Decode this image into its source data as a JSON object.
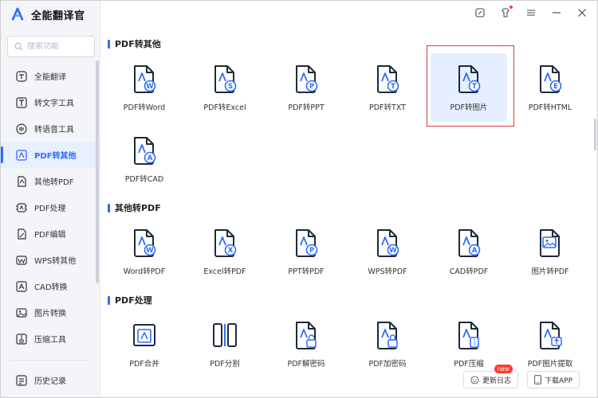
{
  "app": {
    "title": "全能翻译官"
  },
  "search": {
    "placeholder": "搜索功能"
  },
  "sidebar": {
    "items": [
      {
        "label": "全能翻译",
        "icon": "translate-icon",
        "active": false
      },
      {
        "label": "转文字工具",
        "icon": "text-convert-icon",
        "active": false
      },
      {
        "label": "转语音工具",
        "icon": "voice-convert-icon",
        "active": false
      },
      {
        "label": "PDF转其他",
        "icon": "pdf-convert-icon",
        "active": true
      },
      {
        "label": "其他转PDF",
        "icon": "to-pdf-icon",
        "active": false
      },
      {
        "label": "PDF处理",
        "icon": "pdf-process-icon",
        "active": false
      },
      {
        "label": "PDF编辑",
        "icon": "pdf-edit-icon",
        "active": false
      },
      {
        "label": "WPS转其他",
        "icon": "wps-convert-icon",
        "active": false
      },
      {
        "label": "CAD转换",
        "icon": "cad-convert-icon",
        "active": false
      },
      {
        "label": "图片转换",
        "icon": "image-convert-icon",
        "active": false
      },
      {
        "label": "压缩工具",
        "icon": "compress-icon",
        "active": false
      }
    ],
    "history": {
      "label": "历史记录",
      "icon": "history-icon"
    }
  },
  "sections": [
    {
      "title": "PDF转其他",
      "tools": [
        {
          "label": "PDF转Word",
          "badge": "W"
        },
        {
          "label": "PDF转Excel",
          "badge": "S"
        },
        {
          "label": "PDF转PPT",
          "badge": "P"
        },
        {
          "label": "PDF转TXT",
          "badge": "T"
        },
        {
          "label": "PDF转图片",
          "badge": "T"
        },
        {
          "label": "PDF转HTML",
          "badge": "E"
        },
        {
          "label": "PDF转CAD",
          "badge": "A"
        }
      ]
    },
    {
      "title": "其他转PDF",
      "tools": [
        {
          "label": "Word转PDF",
          "badge": "W"
        },
        {
          "label": "Excel转PDF",
          "badge": "X"
        },
        {
          "label": "PPT转PDF",
          "badge": "P"
        },
        {
          "label": "WPS转PDF",
          "badge": "W"
        },
        {
          "label": "CAD转PDF",
          "badge": "A"
        },
        {
          "label": "图片转PDF",
          "badge": "image"
        }
      ]
    },
    {
      "title": "PDF处理",
      "tools": [
        {
          "label": "PDF合并",
          "badge": "merge"
        },
        {
          "label": "PDF分割",
          "badge": "split"
        },
        {
          "label": "PDF解密码",
          "badge": "unlock"
        },
        {
          "label": "PDF加密码",
          "badge": "lock"
        },
        {
          "label": "PDF压缩",
          "badge": "compress"
        },
        {
          "label": "PDF图片提取",
          "badge": "extract"
        }
      ]
    }
  ],
  "floating": {
    "changelog": {
      "label": "更新日志",
      "badge": "new"
    },
    "download": {
      "label": "下载APP"
    }
  },
  "colors": {
    "accent": "#2f6bff",
    "icon": "#1e2a3a",
    "highlight_border": "#e03a3a"
  }
}
